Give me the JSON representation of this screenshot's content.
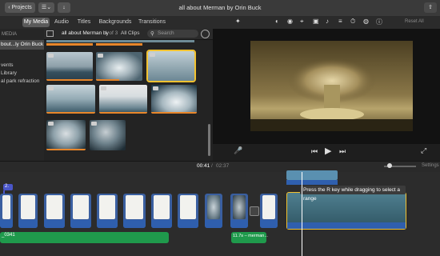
{
  "titlebar": {
    "projects_label": "Projects",
    "window_title": "all about Merman by Orin Buck",
    "share_label": "Share"
  },
  "tabs": [
    {
      "label": "My Media",
      "selected": true
    },
    {
      "label": "Audio"
    },
    {
      "label": "Titles"
    },
    {
      "label": "Backgrounds"
    },
    {
      "label": "Transitions"
    }
  ],
  "sidebar": {
    "header": "MEDIA",
    "items": [
      "bout...ly Orin Buck",
      "vents",
      "Library",
      "al park refraction"
    ]
  },
  "browser": {
    "project_name": "all about Merman by",
    "count": "1 of 3",
    "filter": "All Clips",
    "search_placeholder": "Search"
  },
  "viewer": {
    "reset_all": "Reset All"
  },
  "time": {
    "current": "00:41",
    "separator": "/",
    "total": "02:37",
    "settings_label": "Settings"
  },
  "timeline": {
    "tooltip": "Press the R key while dragging to select a range",
    "audio1_label": "_0341",
    "audio2_label": "11.7s – merman...",
    "marker_label": "2.",
    "playhead_position": 0.686
  },
  "icons": [
    "chevron-left-icon",
    "import-icon",
    "crop-icon",
    "color-icon",
    "volume-icon",
    "speed-icon",
    "info-icon",
    "mic-icon",
    "skip-back-icon",
    "play-icon",
    "skip-forward-icon",
    "fullscreen-icon",
    "search-icon",
    "settings-icon"
  ],
  "colors": {
    "accent": "#e8862a",
    "selection": "#f2c230",
    "audio": "#1f9a4c",
    "clip_blue": "#2f5fae"
  }
}
